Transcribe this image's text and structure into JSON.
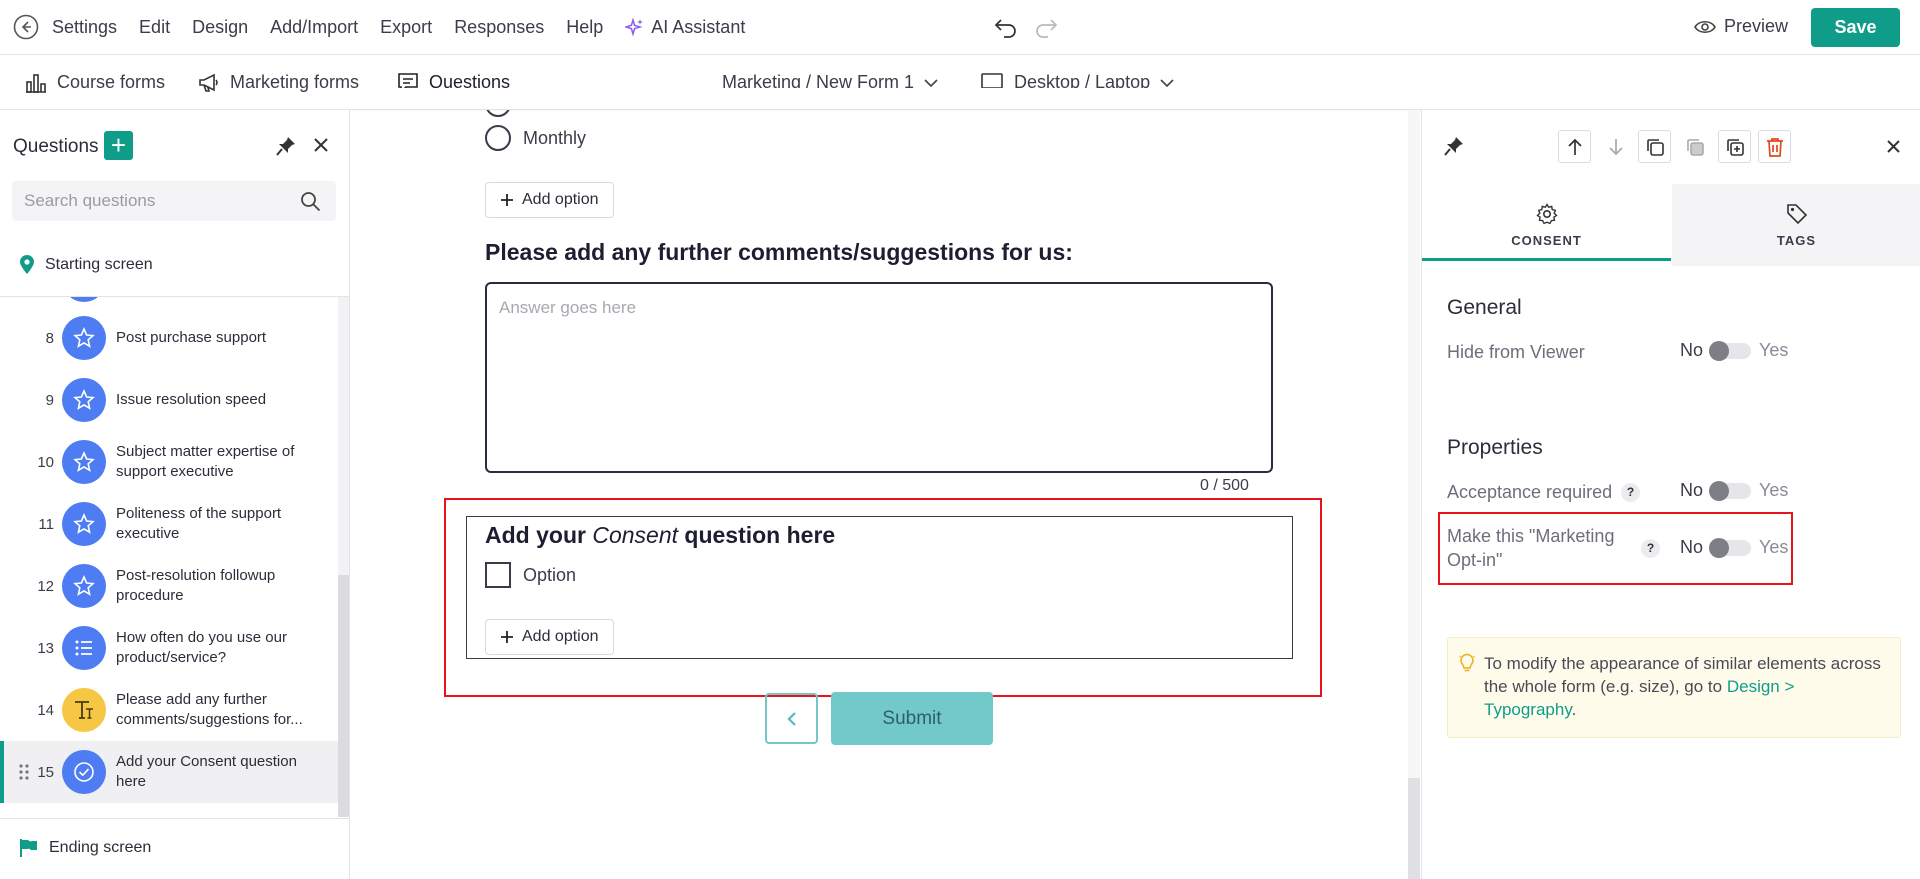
{
  "topbar": {
    "menu": [
      "Settings",
      "Edit",
      "Design",
      "Add/Import",
      "Export",
      "Responses",
      "Help"
    ],
    "ai_label": "AI Assistant",
    "preview_label": "Preview",
    "save_label": "Save"
  },
  "tabbar": {
    "tabs": [
      "Course forms",
      "Marketing forms",
      "Questions"
    ],
    "form_selector": "Marketing / New Form 1",
    "device_selector": "Desktop / Laptop"
  },
  "left_panel": {
    "title": "Questions",
    "add_symbol": "+",
    "search_placeholder": "Search questions",
    "starting_screen": "Starting screen",
    "ending_screen": "Ending screen",
    "questions": [
      {
        "num": "8",
        "label": "Post purchase support",
        "type": "star"
      },
      {
        "num": "9",
        "label": "Issue resolution speed",
        "type": "star"
      },
      {
        "num": "10",
        "label": "Subject matter expertise of support executive",
        "type": "star"
      },
      {
        "num": "11",
        "label": "Politeness of the support executive",
        "type": "star"
      },
      {
        "num": "12",
        "label": "Post-resolution followup procedure",
        "type": "star"
      },
      {
        "num": "13",
        "label": "How often do you use our product/service?",
        "type": "list"
      },
      {
        "num": "14",
        "label": "Please add any further comments/suggestions for...",
        "type": "text"
      },
      {
        "num": "15",
        "label": "Add your Consent question here",
        "type": "check"
      }
    ]
  },
  "canvas": {
    "radio_option": "Monthly",
    "add_option_label": "Add option",
    "comments_question": "Please add any further comments/suggestions for us:",
    "answer_placeholder": "Answer goes here",
    "char_counter": "0 / 500",
    "consent_title_pre": "Add your ",
    "consent_title_em": "Consent",
    "consent_title_post": " question here",
    "consent_option": "Option",
    "submit_label": "Submit"
  },
  "right_panel": {
    "tabs": [
      "CONSENT",
      "TAGS"
    ],
    "general_title": "General",
    "hide_from_viewer": "Hide from Viewer",
    "properties_title": "Properties",
    "acceptance_required": "Acceptance required",
    "marketing_optin": "Make this \"Marketing Opt-in\"",
    "help_symbol": "?",
    "no_label": "No",
    "yes_label": "Yes",
    "tip_text": "To modify the appearance of similar elements across the whole form (e.g. size), go to ",
    "tip_link": "Design > Typography",
    "tip_end": "."
  },
  "colors": {
    "accent": "#0f9d8a",
    "question_blue": "#4d7cf3",
    "question_yellow": "#f6c744",
    "highlight_red": "#e8141c",
    "submit_teal": "#72c9c9"
  }
}
